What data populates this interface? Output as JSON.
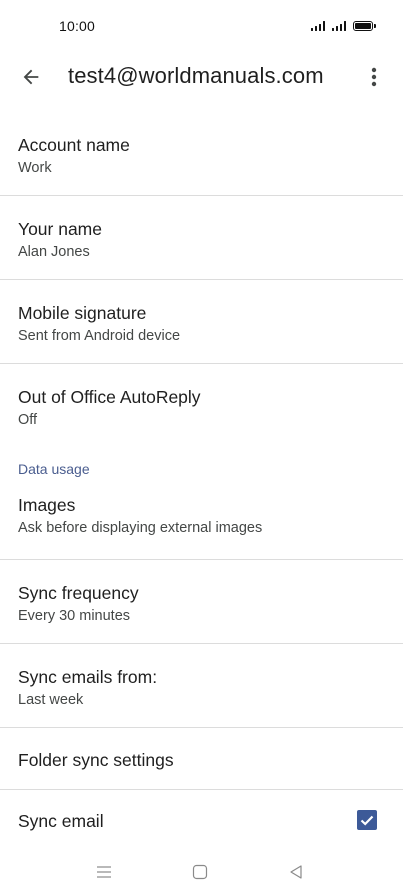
{
  "status_bar": {
    "time": "10:00"
  },
  "app_bar": {
    "title": "test4@worldmanuals.com",
    "back_icon": "arrow-back-icon",
    "more_icon": "more-vert-icon"
  },
  "settings": [
    {
      "title": "Account name",
      "subtitle": "Work"
    },
    {
      "title": "Your name",
      "subtitle": "Alan Jones"
    },
    {
      "title": "Mobile signature",
      "subtitle": "Sent from Android device"
    },
    {
      "title": "Out of Office AutoReply",
      "subtitle": "Off"
    }
  ],
  "data_usage": {
    "header": "Data usage",
    "items": [
      {
        "title": "Images",
        "subtitle": "Ask before displaying external images"
      },
      {
        "title": "Sync frequency",
        "subtitle": "Every 30 minutes"
      },
      {
        "title": "Sync emails from:",
        "subtitle": "Last week"
      },
      {
        "title": "Folder sync settings"
      },
      {
        "title": "Sync email",
        "checked": true
      }
    ]
  },
  "colors": {
    "accent": "#3d5a98",
    "section_header": "#4a5d8f",
    "divider": "#dcdcdc"
  },
  "nav_bar": {
    "menu_icon": "menu-icon",
    "home_icon": "home-square-icon",
    "back_icon": "back-triangle-icon"
  }
}
